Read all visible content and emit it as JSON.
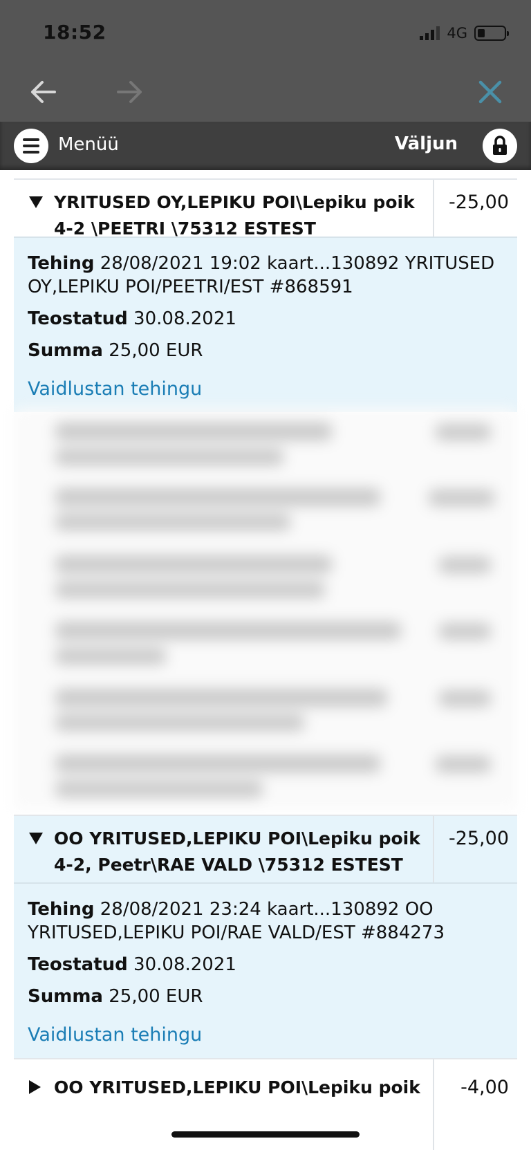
{
  "status": {
    "time": "18:52",
    "network": "4G"
  },
  "nav": {
    "back_icon": "arrow-left-icon",
    "forward_icon": "arrow-right-icon",
    "close_icon": "close-icon"
  },
  "menu": {
    "menu_label": "Menüü",
    "logout_label": "Väljun"
  },
  "transactions": [
    {
      "description": "YRITUSED OY,LEPIKU POI\\Lepiku poik 4-2 \\PEETRI \\75312 ESTEST",
      "amount": "-25,00",
      "details": {
        "tehing_label": "Tehing",
        "tehing_value": "28/08/2021 19:02 kaart...130892 YRITUSED OY,LEPIKU POI/PEETRI/EST #868591",
        "teostatud_label": "Teostatud",
        "teostatud_value": "30.08.2021",
        "summa_label": "Summa",
        "summa_value": "25,00 EUR",
        "dispute_link": "Vaidlustan tehingu"
      }
    },
    {
      "description": "OO YRITUSED,LEPIKU POI\\Lepiku poik 4-2, Peetr\\RAE VALD \\75312 ESTEST",
      "amount": "-25,00",
      "details": {
        "tehing_label": "Tehing",
        "tehing_value": "28/08/2021 23:24 kaart...130892 OO YRITUSED,LEPIKU POI/RAE VALD/EST #884273",
        "teostatud_label": "Teostatud",
        "teostatud_value": "30.08.2021",
        "summa_label": "Summa",
        "summa_value": "25,00 EUR",
        "dispute_link": "Vaidlustan tehingu"
      }
    },
    {
      "description": "OO YRITUSED,LEPIKU POI\\Lepiku poik",
      "amount": "-4,00"
    }
  ],
  "colors": {
    "header_bg": "#555555",
    "menu_bg": "#3f3f3f",
    "detail_bg": "#e6f4fb",
    "link": "#1a7db5",
    "close_x": "#4a90a8"
  }
}
